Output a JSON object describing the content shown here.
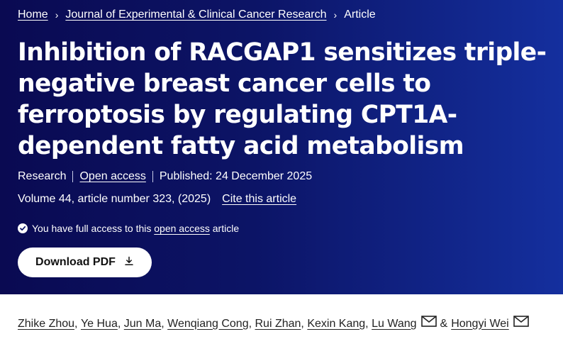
{
  "breadcrumb": {
    "home": "Home",
    "journal": "Journal of Experimental & Clinical Cancer Research",
    "current": "Article",
    "separator": "›"
  },
  "article": {
    "title": "Inhibition of RACGAP1 sensitizes triple-negative breast cancer cells to ferroptosis by regulating CPT1A-dependent fatty acid metabolism",
    "type": "Research",
    "access": "Open access",
    "published": "Published: 24 December 2025",
    "citation": "Volume 44, article number 323, (2025)",
    "cite_link": "Cite this article"
  },
  "access_notice": {
    "prefix": "You have full access to this",
    "link": "open access",
    "suffix": "article"
  },
  "download": {
    "label": "Download PDF"
  },
  "authors": [
    "Zhike Zhou",
    "Ye Hua",
    "Jun Ma",
    "Wenqiang Cong",
    "Rui Zhan",
    "Kexin Kang",
    "Lu Wang",
    "Hongyi Wei"
  ],
  "authors_meta": {
    "ampersand": "&",
    "separator": ",",
    "mail_icon": "envelope-icon"
  }
}
